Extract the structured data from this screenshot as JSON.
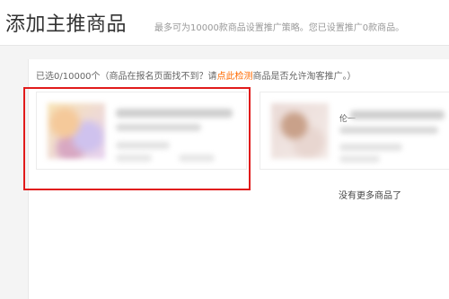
{
  "header": {
    "title": "添加主推商品",
    "hint": "最多可为10000款商品设置推广策略。您已设置推广0款商品。"
  },
  "panel": {
    "status_prefix": "已选0/10000个（商品在报名页面找不到？请",
    "check_link": "点此检测",
    "status_suffix": "商品是否允许淘客推广。）"
  },
  "products": [
    {
      "blurred": true
    },
    {
      "blurred": true,
      "visible_text": "伦一"
    }
  ],
  "footer": {
    "no_more_text": "没有更多商品了"
  },
  "colors": {
    "accent_link": "#ff6a00",
    "highlight_border": "#e11b1b"
  }
}
